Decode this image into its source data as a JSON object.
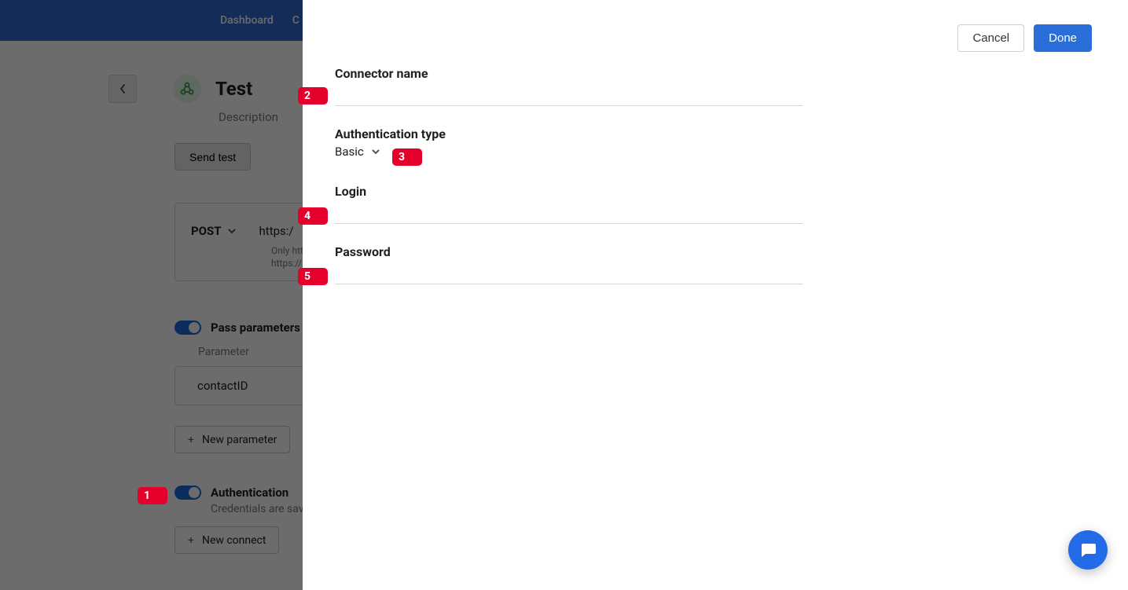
{
  "topbar": {
    "dashboard": "Dashboard",
    "c_partial": "C"
  },
  "back": {},
  "title": {
    "name": "Test",
    "description": "Description"
  },
  "send_test": "Send test",
  "request": {
    "method": "POST",
    "url_prefix": "https:/",
    "help_line1": "Only http",
    "help_line2": "https://"
  },
  "params": {
    "section_label": "Pass parameters",
    "column": "Parameter",
    "row1": "contactID",
    "new_btn": "New parameter"
  },
  "auth": {
    "section_label": "Authentication",
    "sub": "Credentials are sav",
    "new_btn": "New connect"
  },
  "panel": {
    "cancel": "Cancel",
    "done": "Done",
    "fields": {
      "connector_name_label": "Connector name",
      "connector_name_value": "",
      "auth_type_label": "Authentication type",
      "auth_type_value": "Basic",
      "login_label": "Login",
      "login_value": "",
      "password_label": "Password",
      "password_value": ""
    }
  },
  "markers": {
    "m1": "1",
    "m2": "2",
    "m3": "3",
    "m4": "4",
    "m5": "5"
  }
}
